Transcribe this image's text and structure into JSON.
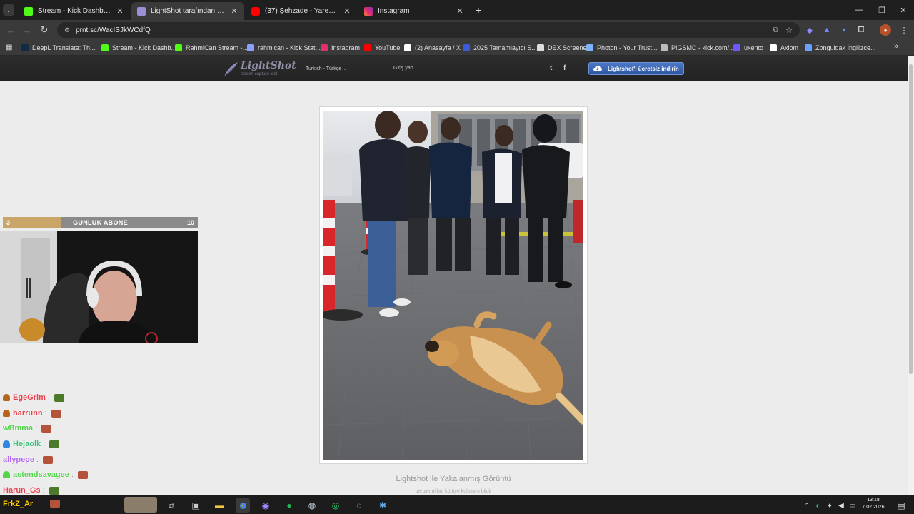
{
  "browser": {
    "tabs": [
      {
        "title": "Stream - Kick Dashboard",
        "color": "#53fc18",
        "active": false
      },
      {
        "title": "LightShot tarafından Ekran Görü",
        "color": "#9b8fd8",
        "active": true
      },
      {
        "title": "(37) Şehzade - Yaren | Official V",
        "color": "#ff0000",
        "active": false
      },
      {
        "title": "Instagram",
        "color": "#e1306c",
        "active": false
      }
    ],
    "new_tab_glyph": "+",
    "url": "prnt.sc/WacISJkWCdfQ",
    "bookmarks": [
      {
        "label": "DeepL Translate: Th...",
        "icon": "deepl-icon",
        "color": "#0f2b46"
      },
      {
        "label": "Stream - Kick Dashb...",
        "icon": "kick-icon",
        "color": "#53fc18"
      },
      {
        "label": "RahmiCan Stream -...",
        "icon": "kick-icon",
        "color": "#53fc18"
      },
      {
        "label": "rahmican - Kick Stat...",
        "icon": "stats-icon",
        "color": "#8aa0ff"
      },
      {
        "label": "Instagram",
        "icon": "instagram-icon",
        "color": "#e1306c"
      },
      {
        "label": "YouTube",
        "icon": "youtube-icon",
        "color": "#ff0000"
      },
      {
        "label": "(2) Anasayfa / X",
        "icon": "x-icon",
        "color": "#ffffff"
      },
      {
        "label": "2025 Tamamlayıcı S...",
        "icon": "globe-icon",
        "color": "#3b5bdb"
      },
      {
        "label": "DEX Screener",
        "icon": "dex-icon",
        "color": "#dddddd"
      },
      {
        "label": "Photon - Your Trust...",
        "icon": "photon-icon",
        "color": "#7fb3ff"
      },
      {
        "label": "PIGSMC - kick.com/...",
        "icon": "globe-icon",
        "color": "#bbbbbb"
      },
      {
        "label": "uxento",
        "icon": "uxento-icon",
        "color": "#6b5bff"
      },
      {
        "label": "Axiom",
        "icon": "axiom-icon",
        "color": "#ffffff"
      },
      {
        "label": "Zonguldak İngilizce...",
        "icon": "translate-icon",
        "color": "#6aa0ff"
      }
    ],
    "more_bookmarks_glyph": "»"
  },
  "lightshot": {
    "logo_name": "LightShot",
    "logo_sub": "screen capture tool",
    "language": "Turkish - Türkçe",
    "login": "Giriş yap",
    "twitter_glyph": "t",
    "facebook_glyph": "f",
    "download_button": "Lightshot'ı ücretsiz indirin",
    "caption": "Lightshot ile Yakalanmış Görüntü",
    "caption_links": "benzerini bul   kötüye kullanım bildir"
  },
  "stream_overlay": {
    "abone_current": "3",
    "abone_label": "GUNLUK ABONE",
    "abone_goal": "10",
    "abone_progress": 0.3,
    "chat": [
      {
        "user": "EgeGrim",
        "color": "#e8414d",
        "badge": "#b5651d",
        "emote": "#4a7a2a"
      },
      {
        "user": "harrunn",
        "color": "#e8414d",
        "badge": "#b5651d",
        "emote": "#b5523a"
      },
      {
        "user": "wBmma",
        "color": "#53d44a",
        "badge": "",
        "emote": "#b5523a"
      },
      {
        "user": "Hejaolk",
        "color": "#3bbf7a",
        "badge": "#2e86de",
        "emote": "#4a7a2a"
      },
      {
        "user": "allypepe",
        "color": "#b36cf0",
        "badge": "",
        "emote": "#b5523a"
      },
      {
        "user": "astendsavagee",
        "color": "#53d44a",
        "badge": "#53d44a",
        "emote": "#b5523a"
      },
      {
        "user": "Harun_Gs",
        "color": "#e8414d",
        "badge": "",
        "emote": "#4a7a2a"
      },
      {
        "user": "FrkZ_Ar",
        "color": "#ffcc00",
        "badge": "",
        "emote": "#b5523a"
      }
    ]
  },
  "taskbar": {
    "time": "13:18",
    "date": "7.02.2026"
  },
  "colors": {
    "accent_blue": "#3a65b5",
    "page_bg": "#ececec",
    "header_bg": "#262626"
  }
}
